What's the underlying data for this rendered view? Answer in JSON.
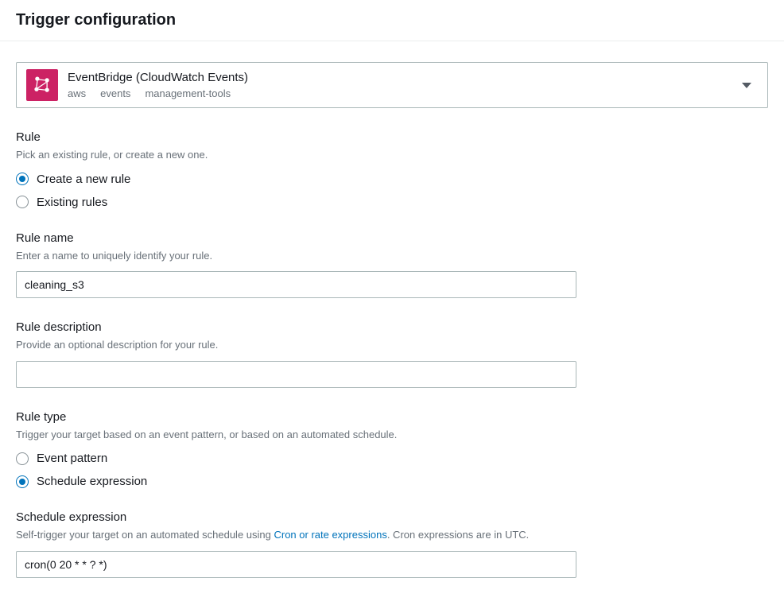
{
  "header": {
    "title": "Trigger configuration"
  },
  "trigger": {
    "title": "EventBridge (CloudWatch Events)",
    "tags": [
      "aws",
      "events",
      "management-tools"
    ]
  },
  "rule": {
    "label": "Rule",
    "hint": "Pick an existing rule, or create a new one.",
    "options": {
      "create": "Create a new rule",
      "existing": "Existing rules"
    }
  },
  "ruleName": {
    "label": "Rule name",
    "hint": "Enter a name to uniquely identify your rule.",
    "value": "cleaning_s3"
  },
  "ruleDescription": {
    "label": "Rule description",
    "hint": "Provide an optional description for your rule.",
    "value": ""
  },
  "ruleType": {
    "label": "Rule type",
    "hint": "Trigger your target based on an event pattern, or based on an automated schedule.",
    "options": {
      "pattern": "Event pattern",
      "schedule": "Schedule expression"
    }
  },
  "scheduleExpression": {
    "label": "Schedule expression",
    "hintPrefix": "Self-trigger your target on an automated schedule using ",
    "hintLink": "Cron or rate expressions",
    "hintSuffix": ". Cron expressions are in UTC.",
    "value": "cron(0 20 * * ? *)"
  }
}
